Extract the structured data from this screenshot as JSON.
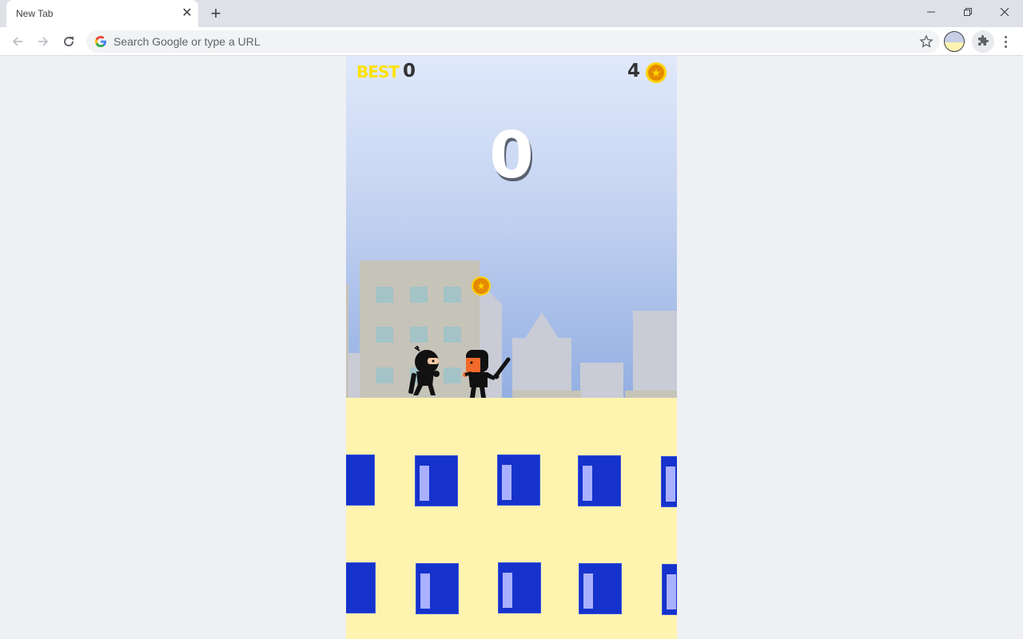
{
  "browser": {
    "tab": {
      "title": "New Tab",
      "close_glyph": "✕"
    },
    "new_tab_glyph": "+",
    "omnibox": {
      "placeholder": "Search Google or type a URL"
    },
    "icons": [
      "back-arrow-icon",
      "forward-arrow-icon",
      "reload-icon",
      "google-g-icon",
      "bookmark-star-icon",
      "profile-avatar",
      "extensions-puzzle-icon",
      "more-menu-icon",
      "minimize-icon",
      "restore-icon",
      "close-icon"
    ]
  },
  "game": {
    "hud": {
      "best_label": "BEST",
      "best_value": "0",
      "coins": "4",
      "coin_glyph": "★"
    },
    "score": "0",
    "field_coin_glyph": "★",
    "characters": [
      "ninja-player",
      "thug-with-bat"
    ],
    "colors": {
      "sky_top": "#e0e9fb",
      "sky_bottom": "#93afe2",
      "ground": "#fff3b0",
      "window": "#1532cc",
      "window_pane": "#a9b0ff",
      "coin": "#e58a00",
      "best_label": "#ffe100"
    }
  }
}
